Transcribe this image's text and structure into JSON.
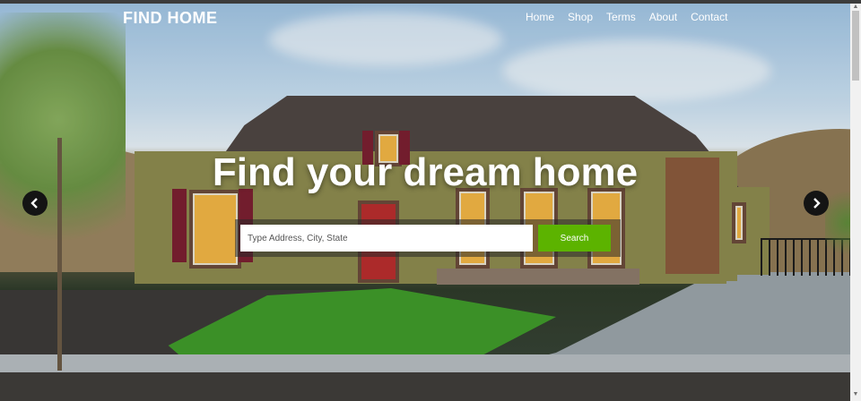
{
  "brand": "FIND HOME",
  "nav": [
    "Home",
    "Shop",
    "Terms",
    "About",
    "Contact"
  ],
  "hero": {
    "headline": "Find your dream home"
  },
  "search": {
    "placeholder": "Type Address, City, State",
    "button_label": "Search"
  },
  "colors": {
    "search_button": "#5cb300",
    "arrow_bg": "#141414"
  },
  "icons": {
    "prev": "chevron-left-icon",
    "next": "chevron-right-icon"
  }
}
